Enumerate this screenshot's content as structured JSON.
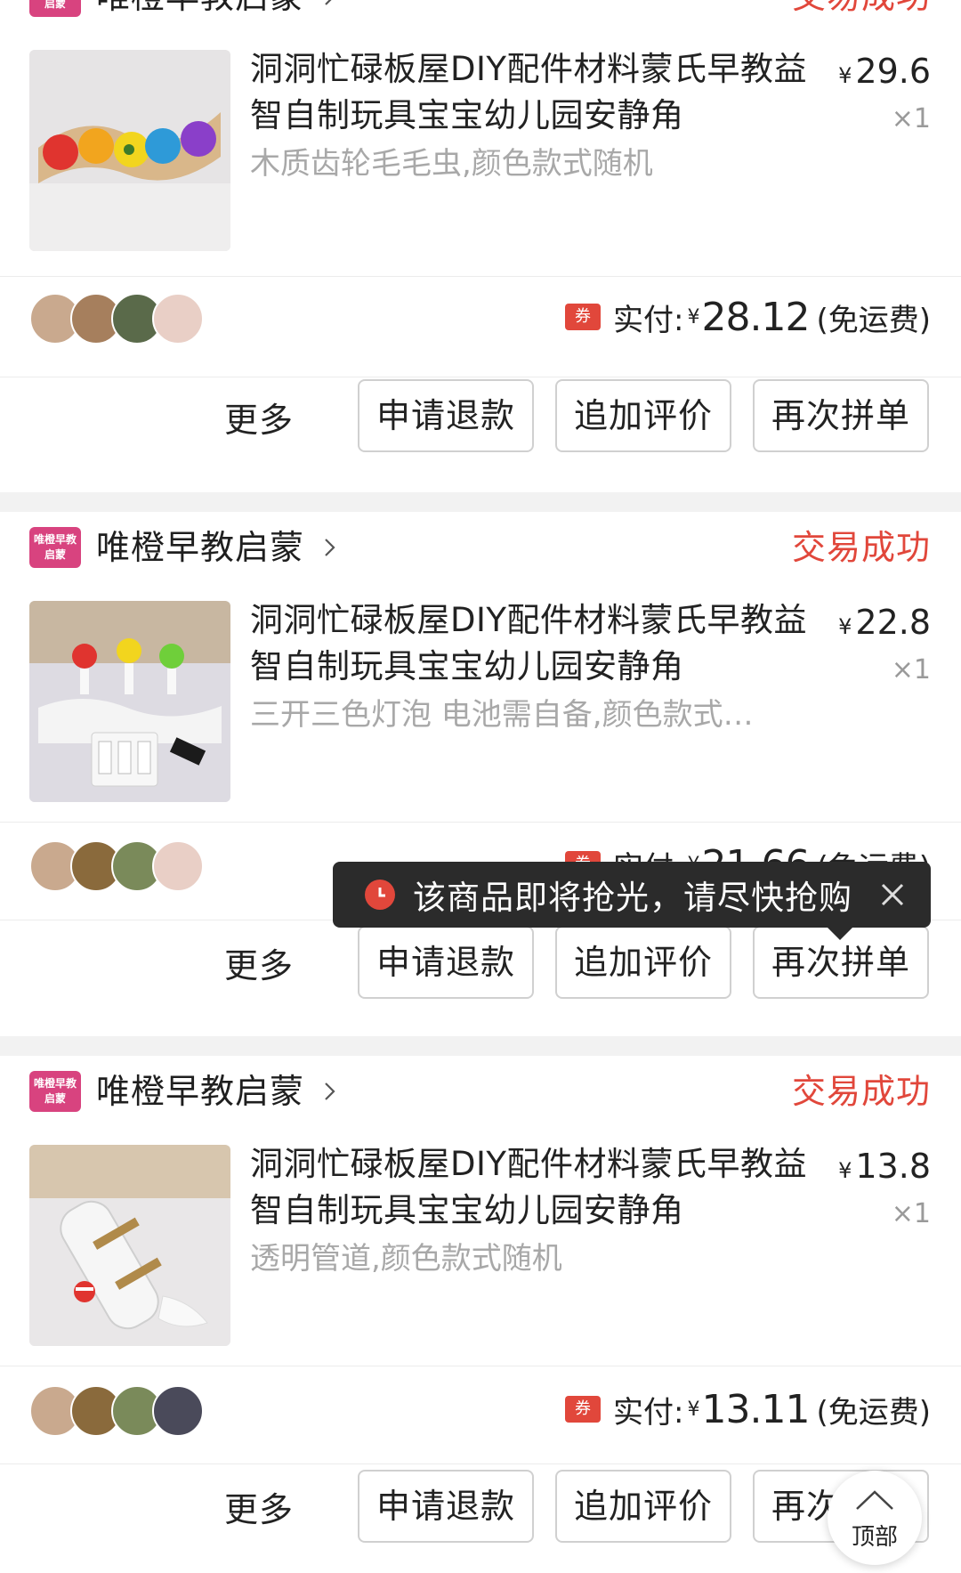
{
  "colors": {
    "accent_red": "#e1473b",
    "shop_logo_pink": "#d8437f",
    "divider_gray": "#f2f2f2",
    "toast_bg": "#2b2b2b"
  },
  "orders": [
    {
      "shop": {
        "logo_text": "唯橙早教启蒙",
        "name": "唯橙早教启蒙"
      },
      "status": "交易成功",
      "product": {
        "title": "洞洞忙碌板屋DIY配件材料蒙氏早教益智自制玩具宝宝幼儿园安静角",
        "spec": "木质齿轮毛毛虫,颜色款式随机",
        "image_icon": "wooden-gear-caterpillar-image",
        "currency": "¥",
        "unit_price": "29.6",
        "quantity": "×1"
      },
      "payment": {
        "coupon_label": "券",
        "label": "实付:",
        "currency": "¥",
        "amount": "28.12",
        "note": "(免运费)"
      },
      "actions": {
        "more": "更多",
        "refund": "申请退款",
        "review": "追加评价",
        "rebuy": "再次拼单"
      }
    },
    {
      "shop": {
        "logo_text": "唯橙早教启蒙",
        "name": "唯橙早教启蒙"
      },
      "status": "交易成功",
      "product": {
        "title": "洞洞忙碌板屋DIY配件材料蒙氏早教益智自制玩具宝宝幼儿园安静角",
        "spec": "三开三色灯泡 电池需自备,颜色款式…",
        "image_icon": "three-color-bulbs-switch-image",
        "currency": "¥",
        "unit_price": "22.8",
        "quantity": "×1"
      },
      "payment": {
        "coupon_label": "券",
        "label": "实付:",
        "currency": "¥",
        "amount": "21.66",
        "note": "(免运费)"
      },
      "actions": {
        "more": "更多",
        "refund": "申请退款",
        "review": "追加评价",
        "rebuy": "再次拼单"
      }
    },
    {
      "shop": {
        "logo_text": "唯橙早教启蒙",
        "name": "唯橙早教启蒙"
      },
      "status": "交易成功",
      "product": {
        "title": "洞洞忙碌板屋DIY配件材料蒙氏早教益智自制玩具宝宝幼儿园安静角",
        "spec": "透明管道,颜色款式随机",
        "image_icon": "transparent-pipe-image",
        "currency": "¥",
        "unit_price": "13.8",
        "quantity": "×1"
      },
      "payment": {
        "coupon_label": "券",
        "label": "实付:",
        "currency": "¥",
        "amount": "13.11",
        "note": "(免运费)"
      },
      "actions": {
        "more": "更多",
        "refund": "申请退款",
        "review": "追加评价",
        "rebuy": "再次拼单"
      }
    }
  ],
  "toast": {
    "icon": "clock-icon",
    "text": "该商品即将抢光，请尽快抢购",
    "close_icon": "close-icon"
  },
  "back_to_top": {
    "icon": "arrow-up-icon",
    "label": "顶部"
  }
}
